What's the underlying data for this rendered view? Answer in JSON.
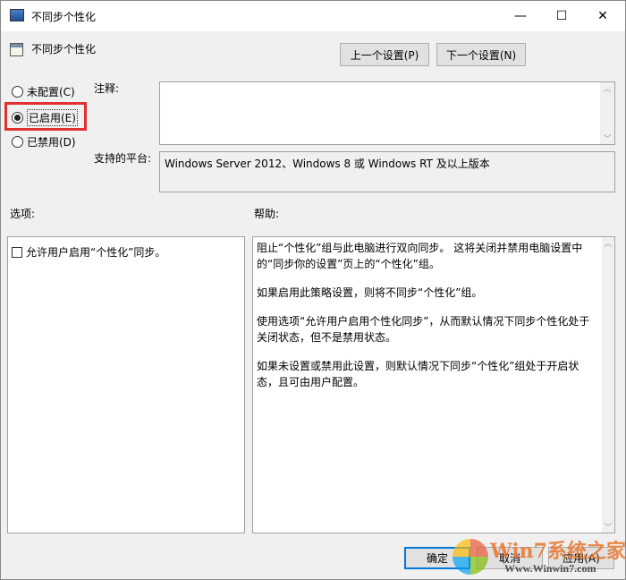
{
  "window": {
    "title": "不同步个性化",
    "minimize": "—",
    "maximize": "☐",
    "close": "✕"
  },
  "header": {
    "policy_name": "不同步个性化",
    "prev_button": "上一个设置(P)",
    "next_button": "下一个设置(N)"
  },
  "state": {
    "options": [
      {
        "label": "未配置(C)",
        "selected": false
      },
      {
        "label": "已启用(E)",
        "selected": true
      },
      {
        "label": "已禁用(D)",
        "selected": false
      }
    ]
  },
  "comment": {
    "label": "注释:",
    "value": ""
  },
  "platform": {
    "label": "支持的平台:",
    "value": "Windows Server 2012、Windows 8 或 Windows RT 及以上版本"
  },
  "options_panel": {
    "label": "选项:",
    "checkbox_label": "允许用户启用“个性化”同步。",
    "checked": false
  },
  "help_panel": {
    "label": "帮助:",
    "paragraphs": [
      "阻止“个性化”组与此电脑进行双向同步。 这将关闭并禁用电脑设置中的“同步你的设置”页上的“个性化”组。",
      "如果启用此策略设置，则将不同步“个性化”组。",
      "使用选项“允许用户启用个性化同步”，从而默认情况下同步个性化处于关闭状态，但不是禁用状态。",
      "如果未设置或禁用此设置，则默认情况下同步“个性化”组处于开启状态，且可由用户配置。"
    ]
  },
  "footer": {
    "ok": "确定",
    "cancel": "取消",
    "apply": "应用(A)"
  },
  "watermark": {
    "text": "Win7系统之家",
    "url": "Www.Winwin7.com"
  },
  "colors": {
    "highlight": "#e03030",
    "focus": "#0078d7"
  }
}
